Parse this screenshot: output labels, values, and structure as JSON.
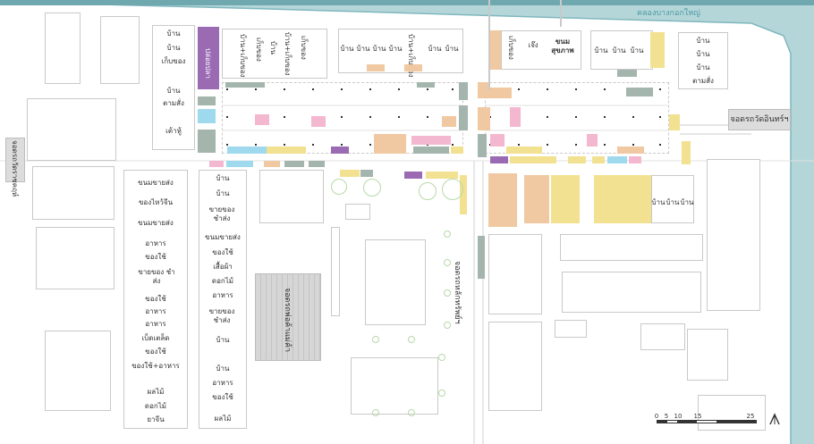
{
  "map": {
    "canal_label": "คลองบางกอกใหญ่",
    "parking_right": "จอดรถวัดอินทร์ฯ",
    "parking_left": "จอดรถวัดราชคฤห์",
    "parking_center": "จอดรถพ่อค้าแม่ค้า",
    "parking_road": "จอดรถหลักทรัพย์ฯ",
    "fish_pier": "ปล่อยปลา",
    "scale": {
      "ticks": [
        "0",
        "5",
        "10",
        "15",
        "25"
      ]
    },
    "north_icon": "north-arrow-icon",
    "colors": {
      "canal": "#b5d6d9",
      "canal_edge": "#7fb7bd",
      "orange": "#f0c8a2",
      "yellow": "#f2e191",
      "pink": "#f3b7cf",
      "purple": "#9a6ab3",
      "gray_green": "#a4b5ad",
      "cyan": "#9fd9ee",
      "plaza": "#dcdcdc"
    }
  },
  "top_left_column": [
    "บ้าน",
    "บ้าน",
    "เก็บของ",
    "บ้าน",
    "ตามสั่ง",
    "เต้าหู้"
  ],
  "top_row_mid_left": [
    "บ้าน+เก็บของ",
    "เก็บของ",
    "บ้าน",
    "บ้าน+เก็บของ",
    "เก็บของ"
  ],
  "top_row_mid": [
    "บ้าน",
    "บ้าน",
    "บ้าน",
    "บ้าน",
    "บ้าน+เก็บของ",
    "บ้าน",
    "บ้าน"
  ],
  "top_row_right": [
    "เก็บของ",
    "เจ๊ง",
    "ขนม สุขภาพ",
    "บ้าน",
    "บ้าน",
    "บ้าน"
  ],
  "top_right_column": [
    "บ้าน",
    "บ้าน",
    "บ้าน",
    "ตามสั่ง"
  ],
  "lower_right_houses": [
    "บ้าน",
    "บ้าน",
    "บ้าน"
  ],
  "left_column": [
    "ขนมขายส่ง",
    "ของไหว้จีน",
    "ขนมขายส่ง",
    "อาหาร",
    "ของใช้",
    "ขายของ ชำส่ง",
    "ของใช้",
    "อาหาร",
    "อาหาร",
    "เบ็ดเตล็ด",
    "ของใช้",
    "ของใช้+อาหาร",
    "ผลไม้",
    "ดอกไม้",
    "ยาจีน"
  ],
  "middle_column": [
    "บ้าน",
    "บ้าน",
    "ขายของ ชำส่ง",
    "ขนมขายส่ง",
    "ของใช้",
    "เสื้อผ้า",
    "ดอกไม้",
    "อาหาร",
    "ขายของ ชำส่ง",
    "บ้าน",
    "บ้าน",
    "อาหาร",
    "ของใช้",
    "ผลไม้"
  ]
}
